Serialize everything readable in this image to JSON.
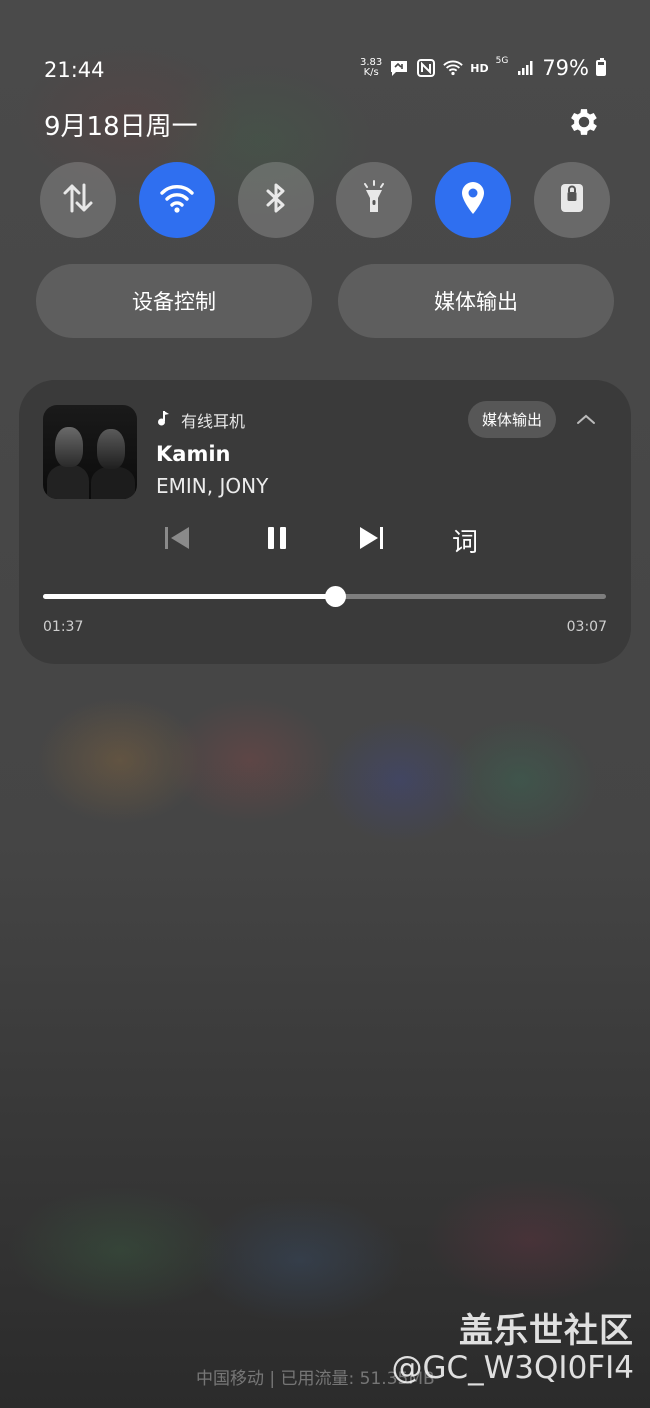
{
  "status_bar": {
    "time": "21:44",
    "net_speed_value": "3.83",
    "net_speed_unit": "K/s",
    "hd_label": "HD",
    "network_label": "5G",
    "battery_percent": "79%",
    "icons": [
      "message-icon",
      "nfc-icon",
      "wifi-icon",
      "signal-icon",
      "battery-icon"
    ]
  },
  "header": {
    "date": "9月18日周一"
  },
  "quick_settings": [
    {
      "name": "mobile-data",
      "icon": "updown-arrows-icon",
      "active": false
    },
    {
      "name": "wifi",
      "icon": "wifi-icon",
      "active": true
    },
    {
      "name": "bluetooth",
      "icon": "bluetooth-icon",
      "active": false
    },
    {
      "name": "flashlight",
      "icon": "flashlight-icon",
      "active": false
    },
    {
      "name": "location",
      "icon": "location-pin-icon",
      "active": true
    },
    {
      "name": "lock",
      "icon": "lock-icon",
      "active": false
    }
  ],
  "pills": {
    "device_control": "设备控制",
    "media_output": "媒体输出"
  },
  "media": {
    "source": "有线耳机",
    "output_label": "媒体输出",
    "title": "Kamin",
    "artist": "EMIN, JONY",
    "lyrics_label": "词",
    "elapsed": "01:37",
    "duration": "03:07",
    "progress": 0.519
  },
  "footer": {
    "carrier": "中国移动 | 已用流量: 51.35MB",
    "watermark_brand": "盖乐世社区",
    "watermark_user": "@GC_W3QI0FI4"
  },
  "colors": {
    "accent": "#2f6ff0",
    "card": "#3a3a3a"
  }
}
